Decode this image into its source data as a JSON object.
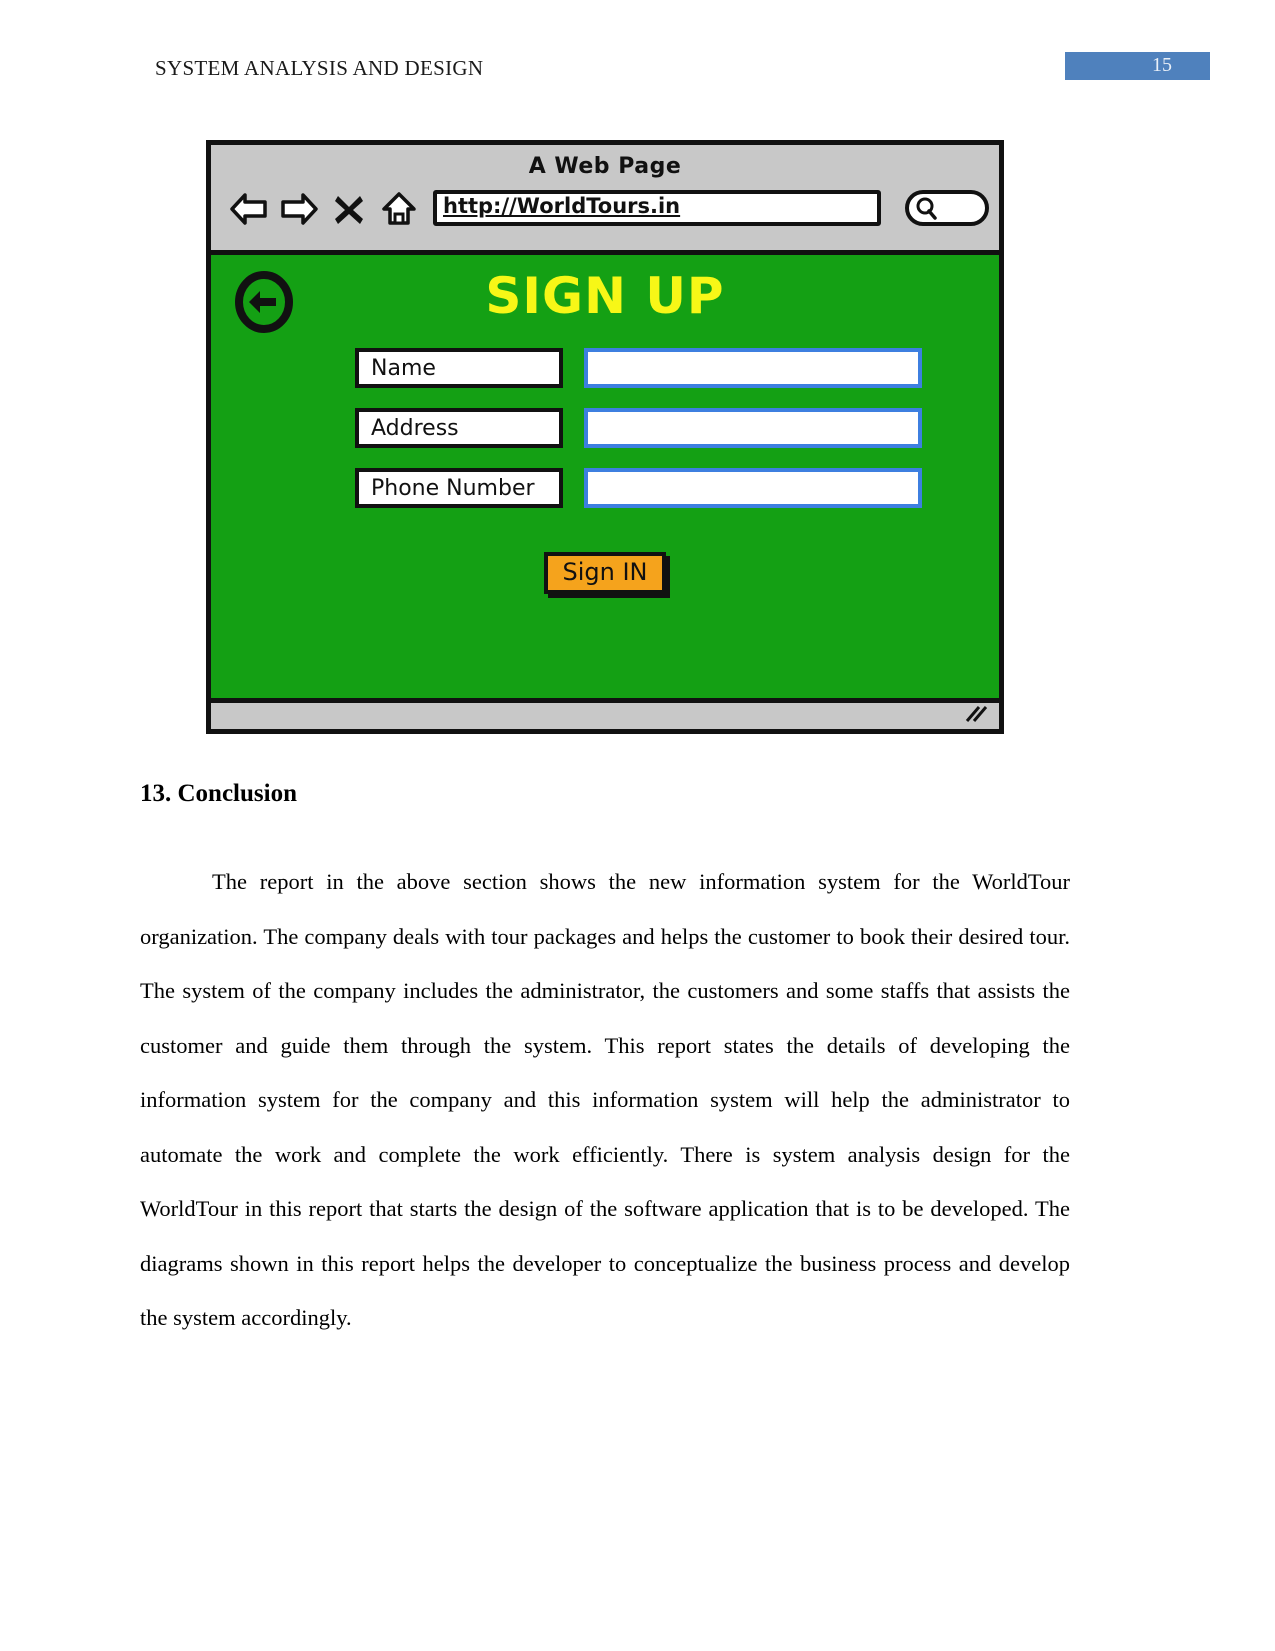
{
  "header": {
    "title": "SYSTEM ANALYSIS AND DESIGN",
    "page_number": "15",
    "badge_color": "#4f81bd"
  },
  "wireframe": {
    "window_title": "A Web Page",
    "url": "http://WorldTours.in",
    "search_placeholder": "",
    "toolbar_icons": [
      "back-arrow-icon",
      "forward-arrow-icon",
      "close-x-icon",
      "home-icon"
    ],
    "search_icon": "magnifier-icon",
    "back_icon": "circle-back-arrow-icon",
    "resize_icon": "resize-grip-icon",
    "page_heading": "SIGN UP",
    "colors": {
      "viewport_green": "#14a014",
      "heading_yellow": "#f7f717",
      "input_border_blue": "#3d7fe0",
      "button_orange": "#f5a31c",
      "chrome_gray": "#c8c8c8"
    },
    "fields": [
      {
        "label": "Name",
        "value": ""
      },
      {
        "label": "Address",
        "value": ""
      },
      {
        "label": "Phone Number",
        "value": ""
      }
    ],
    "submit_label": "Sign IN"
  },
  "document": {
    "section_heading": "13. Conclusion",
    "paragraph": "The report in the above section shows the new information system for the WorldTour organization. The company deals with tour packages and helps the customer to book their desired tour. The system of the company includes the administrator, the customers and some staffs that assists the customer and guide them through the system. This report states the details of developing the information system for the company and this information system will help the administrator to automate the work and complete the work efficiently. There is system analysis design for the WorldTour in this report that starts the design of the software application that is to be developed. The diagrams shown in this report helps the developer to conceptualize the business process and develop the system accordingly."
  }
}
